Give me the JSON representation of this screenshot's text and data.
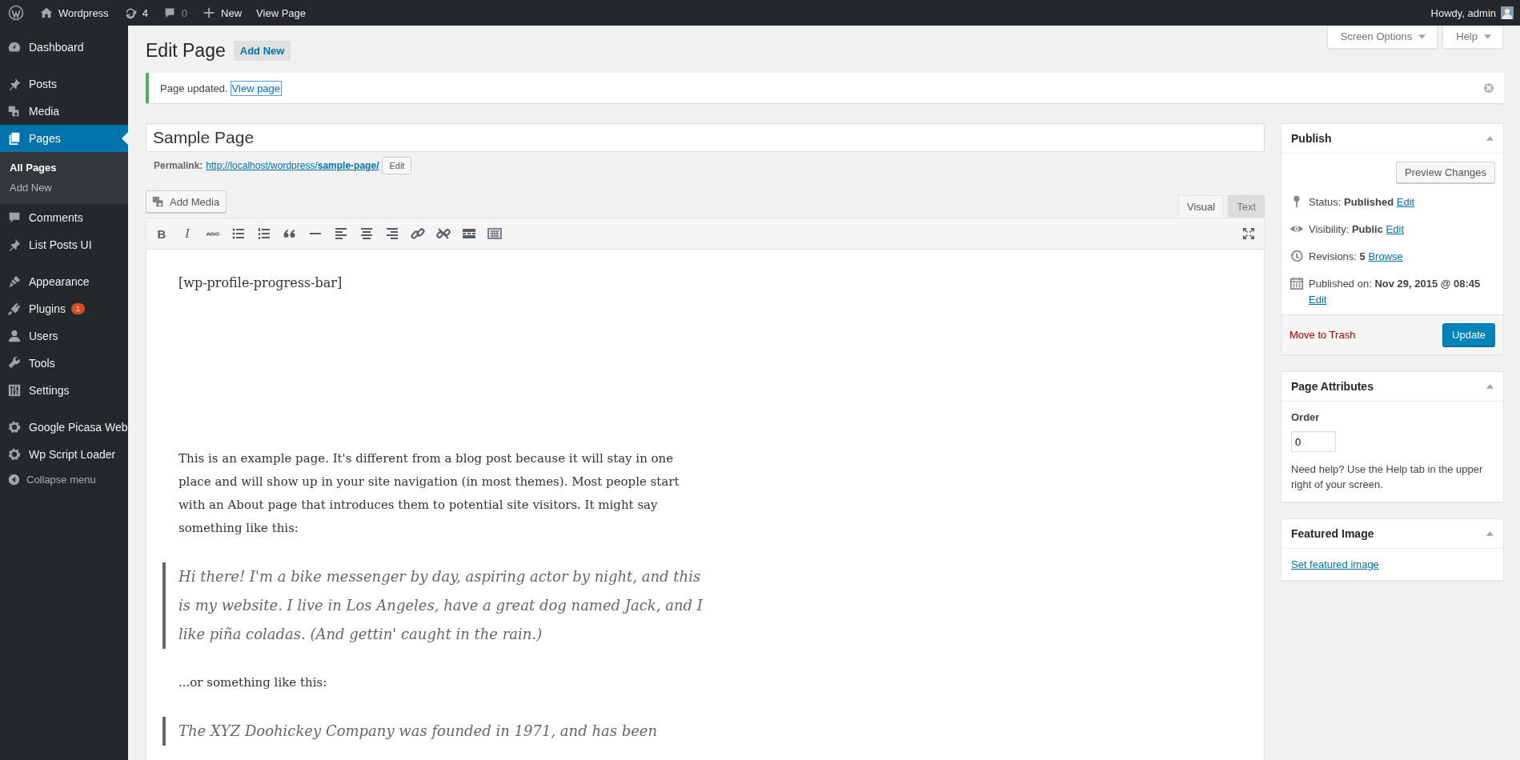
{
  "admin_bar": {
    "site": "Wordpress",
    "updates": "4",
    "comments": "0",
    "new": "New",
    "view": "View Page",
    "greeting": "Howdy, admin"
  },
  "menu": [
    [
      {
        "label": "Dashboard",
        "selected": false
      }
    ],
    [
      {
        "label": "Posts",
        "selected": false
      },
      {
        "label": "Media",
        "selected": false
      },
      {
        "label": "Pages",
        "selected": true,
        "children": [
          {
            "label": "All Pages",
            "selected": true
          },
          {
            "label": "Add New",
            "selected": false
          }
        ]
      },
      {
        "label": "Comments",
        "selected": false
      },
      {
        "label": "List Posts UI",
        "selected": false
      }
    ],
    [
      {
        "label": "Appearance",
        "selected": false
      },
      {
        "label": "Plugins",
        "selected": false,
        "badge": "1"
      },
      {
        "label": "Users",
        "selected": false
      },
      {
        "label": "Tools",
        "selected": false
      },
      {
        "label": "Settings",
        "selected": false
      }
    ],
    [
      {
        "label": "Google Picasa Web",
        "selected": false
      },
      {
        "label": "Wp Script Loader",
        "selected": false
      }
    ]
  ],
  "collapse": "Collapse menu",
  "screen_buttons": [
    "Screen Options",
    "Help"
  ],
  "heading": {
    "title": "Edit Page",
    "add_new": "Add New"
  },
  "notice": {
    "text": "Page updated.",
    "link": "View page"
  },
  "title_field": {
    "value": "Sample Page"
  },
  "permalink": {
    "label": "Permalink:",
    "base": "http://localhost/wordpress/",
    "slug": "sample-page/",
    "edit": "Edit"
  },
  "add_media": "Add Media",
  "editor_tabs": [
    {
      "label": "Visual",
      "selected": true
    },
    {
      "label": "Text",
      "selected": false
    }
  ],
  "toolbar": {
    "bold": "B",
    "italic": "I",
    "strike": "ABC"
  },
  "content": [
    {
      "kind": "shortcode",
      "text": "[wp-profile-progress-bar]"
    },
    {
      "kind": "paragraph",
      "text": "This is an example page. It's different from a blog post because it will stay in one place and will show up in your site navigation (in most themes). Most people start with an About page that introduces them to potential site visitors. It might say something like this:"
    },
    {
      "kind": "quote",
      "text": "Hi there! I'm a bike messenger by day, aspiring actor by night, and this is my website. I live in Los Angeles, have a great dog named Jack, and I like piña coladas. (And gettin' caught in the rain.)"
    },
    {
      "kind": "paragraph",
      "text": "...or something like this:"
    },
    {
      "kind": "quote",
      "text": "The XYZ Doohickey Company was founded in 1971, and has been"
    }
  ],
  "publish": {
    "title": "Publish",
    "preview": "Preview Changes",
    "rows": [
      {
        "label": "Status:",
        "value": "Published",
        "link": "Edit"
      },
      {
        "label": "Visibility:",
        "value": "Public",
        "link": "Edit"
      },
      {
        "label": "Revisions:",
        "value": "5",
        "link": "Browse"
      },
      {
        "label": "Published on:",
        "value": "Nov 29, 2015 @ 08:45",
        "link": "Edit"
      }
    ],
    "trash": "Move to Trash",
    "update": "Update"
  },
  "page_attributes": {
    "title": "Page Attributes",
    "order_label": "Order",
    "order_value": "0",
    "help": "Need help? Use the Help tab in the upper right of your screen."
  },
  "featured_image": {
    "title": "Featured Image",
    "link": "Set featured image"
  }
}
